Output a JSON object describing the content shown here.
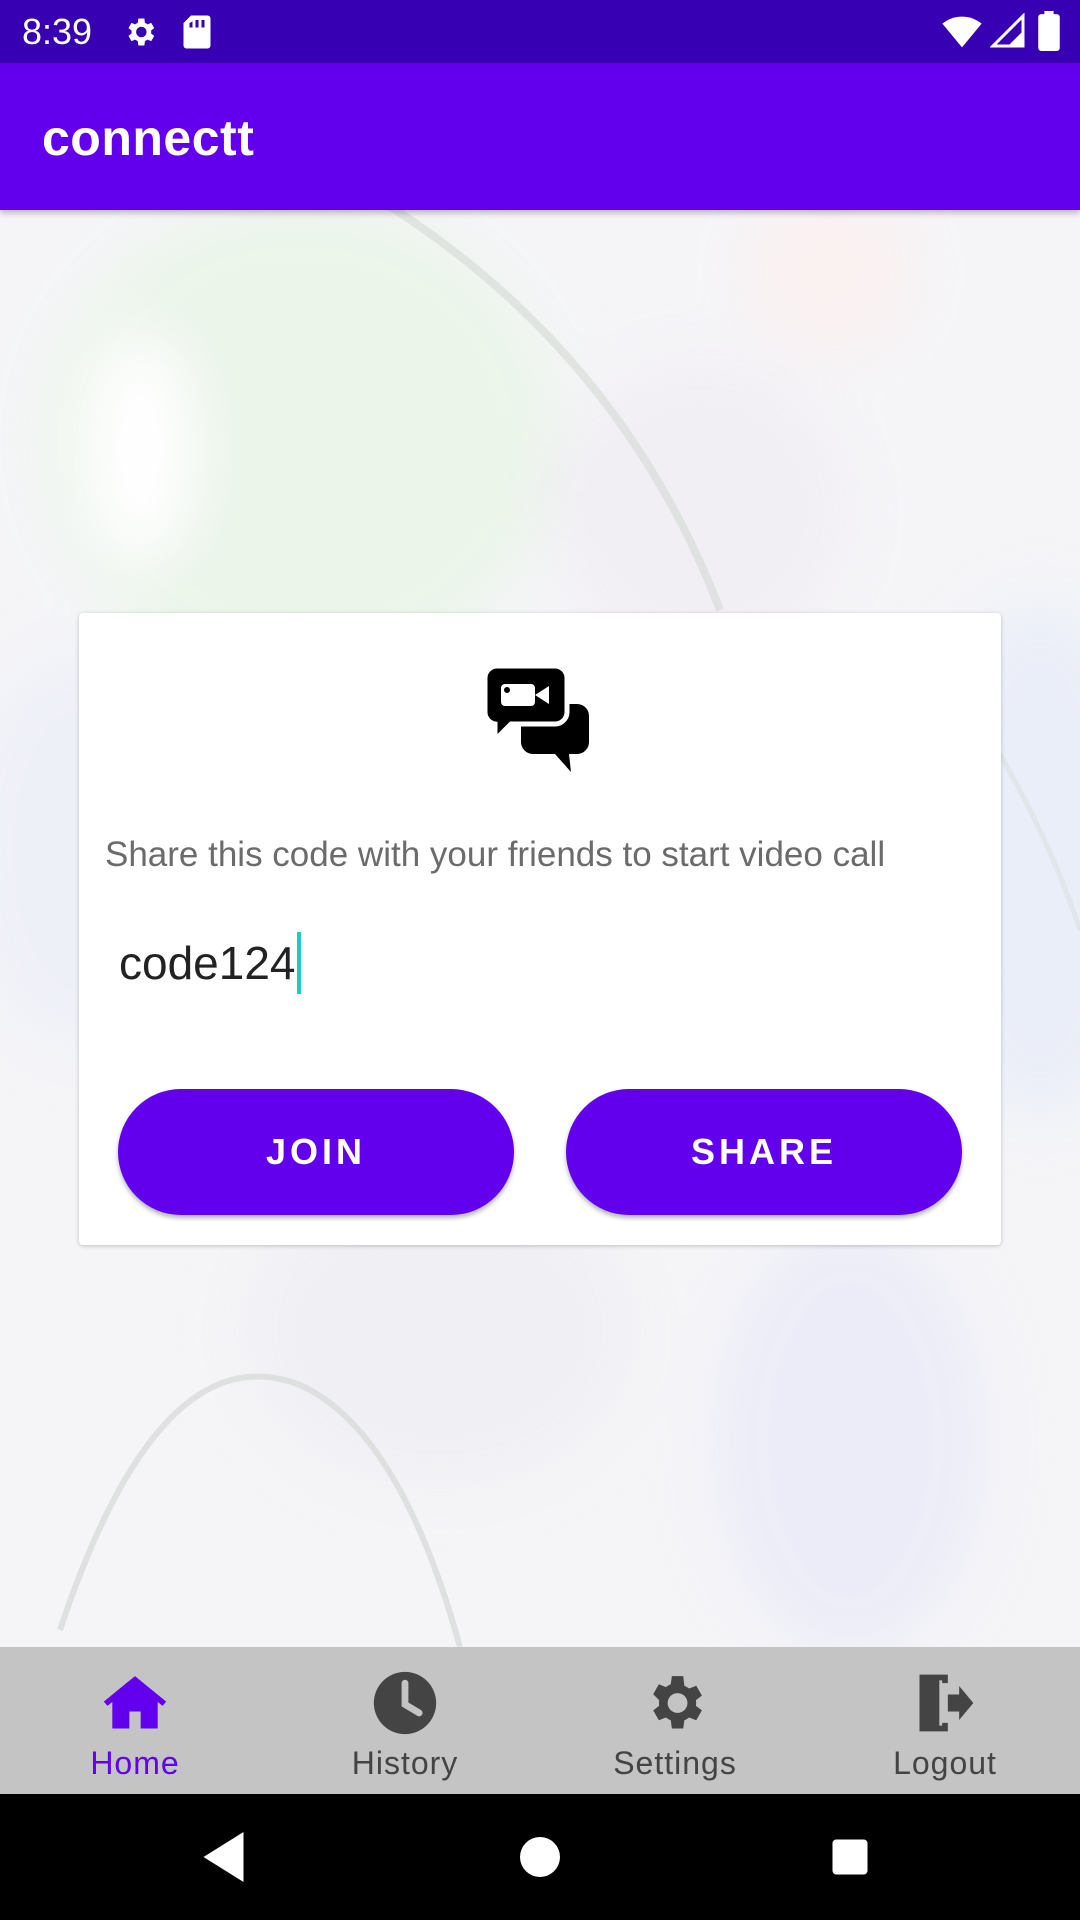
{
  "status_bar": {
    "time": "8:39",
    "icons": [
      "gear-icon",
      "sd-card-icon",
      "wifi-icon",
      "signal-icon",
      "battery-icon"
    ]
  },
  "app_bar": {
    "title": "connectt"
  },
  "card": {
    "icon": "video-chat-icon",
    "message": "Share this code with your friends to start video call",
    "code_value": "code124",
    "join_label": "JOIN",
    "share_label": "SHARE"
  },
  "bottom_nav": {
    "items": [
      {
        "label": "Home",
        "icon": "home-icon",
        "active": true
      },
      {
        "label": "History",
        "icon": "clock-icon",
        "active": false
      },
      {
        "label": "Settings",
        "icon": "gear-icon",
        "active": false
      },
      {
        "label": "Logout",
        "icon": "logout-icon",
        "active": false
      }
    ]
  },
  "system_nav": {
    "buttons": [
      "back-icon",
      "home-circle-icon",
      "recents-icon"
    ]
  },
  "colors": {
    "status_bar": "#3700b3",
    "primary": "#6200ee",
    "nav_bg": "#c4c4c4",
    "caret": "#1ecbc2"
  }
}
